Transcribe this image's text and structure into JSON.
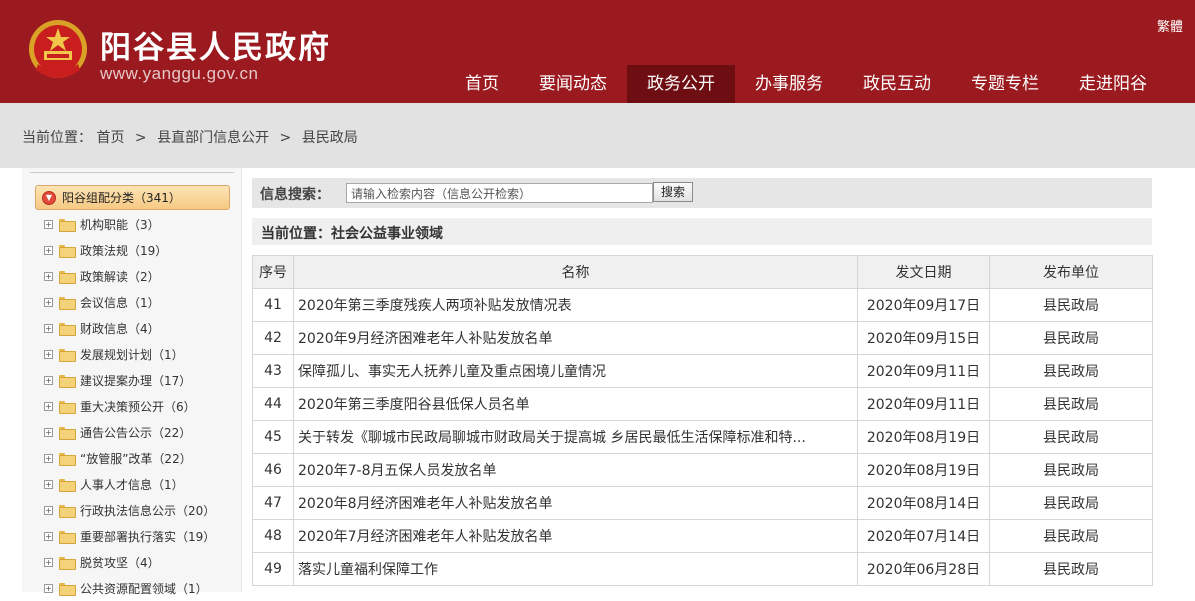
{
  "header": {
    "site_title": "阳谷县人民政府",
    "site_url": "www.yanggu.gov.cn",
    "lang_toggle": "繁體",
    "emblem_icon": "national-emblem-icon",
    "nav": [
      "首页",
      "要闻动态",
      "政务公开",
      "办事服务",
      "政民互动",
      "专题专栏",
      "走进阳谷"
    ],
    "active_nav": "政务公开",
    "brand_color": "#9b1a1f",
    "active_color": "#6f0e12"
  },
  "breadcrumb": {
    "label": "当前位置：",
    "items": [
      "首页",
      "县直部门信息公开",
      "县民政局"
    ],
    "separator": ">"
  },
  "sidebar": {
    "root": {
      "label": "阳谷组配分类（341）",
      "icon": "collapse-down-icon"
    },
    "items": [
      {
        "label": "机构职能（3）"
      },
      {
        "label": "政策法规（19）"
      },
      {
        "label": "政策解读（2）"
      },
      {
        "label": "会议信息（1）"
      },
      {
        "label": "财政信息（4）"
      },
      {
        "label": "发展规划计划（1）"
      },
      {
        "label": "建议提案办理（17）"
      },
      {
        "label": "重大决策预公开（6）"
      },
      {
        "label": "通告公告公示（22）"
      },
      {
        "label": "“放管服”改革（22）"
      },
      {
        "label": "人事人才信息（1）"
      },
      {
        "label": "行政执法信息公示（20）"
      },
      {
        "label": "重要部署执行落实（19）"
      },
      {
        "label": "脱贫攻坚（4）"
      },
      {
        "label": "公共资源配置领域（1）"
      }
    ]
  },
  "search": {
    "label": "信息搜索：",
    "placeholder": "请输入检索内容（信息公开检索）",
    "button": "搜索"
  },
  "current": {
    "label": "当前位置：社会公益事业领域"
  },
  "table": {
    "headers": [
      "序号",
      "名称",
      "发文日期",
      "发布单位"
    ],
    "rows": [
      {
        "no": "41",
        "title": "2020年第三季度残疾人两项补贴发放情况表",
        "date": "2020年09月17日",
        "unit": "县民政局"
      },
      {
        "no": "42",
        "title": "2020年9月经济困难老年人补贴发放名单",
        "date": "2020年09月15日",
        "unit": "县民政局"
      },
      {
        "no": "43",
        "title": "保障孤儿、事实无人抚养儿童及重点困境儿童情况",
        "date": "2020年09月11日",
        "unit": "县民政局"
      },
      {
        "no": "44",
        "title": "2020年第三季度阳谷县低保人员名单",
        "date": "2020年09月11日",
        "unit": "县民政局"
      },
      {
        "no": "45",
        "title": "关于转发《聊城市民政局聊城市财政局关于提高城 乡居民最低生活保障标准和特...",
        "date": "2020年08月19日",
        "unit": "县民政局"
      },
      {
        "no": "46",
        "title": "2020年7-8月五保人员发放名单",
        "date": "2020年08月19日",
        "unit": "县民政局"
      },
      {
        "no": "47",
        "title": "2020年8月经济困难老年人补贴发放名单",
        "date": "2020年08月14日",
        "unit": "县民政局"
      },
      {
        "no": "48",
        "title": "2020年7月经济困难老年人补贴发放名单",
        "date": "2020年07月14日",
        "unit": "县民政局"
      },
      {
        "no": "49",
        "title": "落实儿童福利保障工作",
        "date": "2020年06月28日",
        "unit": "县民政局"
      }
    ]
  }
}
